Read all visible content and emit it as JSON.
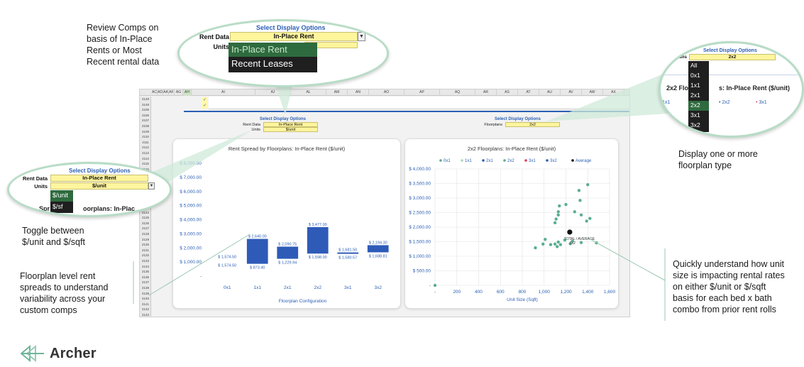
{
  "annotations": {
    "review_comps": [
      "Review Comps on",
      "basis of In-Place",
      "Rents or Most",
      "Recent rental data"
    ],
    "display_floorplan": [
      "Display one or more",
      "floorplan type"
    ],
    "toggle_units": [
      "Toggle between",
      "$/unit and $/sqft"
    ],
    "floorplan_spreads": [
      "Floorplan level rent",
      "spreads to understand",
      "variability across your",
      "custom comps"
    ],
    "unit_size": [
      "Quickly understand how unit",
      "size is impacting rental rates",
      "on either $/unit or $/sqft",
      "basis for each bed x bath",
      "combo from prior rent rolls"
    ]
  },
  "bubble_rent": {
    "title": "Select Display Options",
    "rent_label": "Rent Data",
    "rent_value": "In-Place Rent",
    "units_label": "Units",
    "options": [
      "In-Place Rent",
      "Recent Leases"
    ],
    "selected": "In-Place Rent"
  },
  "bubble_units": {
    "title": "Select Display Options",
    "rent_label": "Rent Data",
    "rent_value": "In-Place Rent",
    "units_label": "Units",
    "units_value": "$/unit",
    "options": [
      "$/unit",
      "$/sf"
    ],
    "selected": "$/unit",
    "behind_text": "Spr",
    "behind_text2": "oorplans: In-Plac"
  },
  "bubble_floorplans": {
    "title": "Select Display Options",
    "label": "orplans",
    "value": "2x2",
    "options": [
      "All",
      "0x1",
      "1x1",
      "2x1",
      "2x2",
      "3x1",
      "3x2"
    ],
    "selected": "2x2",
    "behind_title_a": "2x2 Flo",
    "behind_title_b": "s: In-Place Rent ($/unit)",
    "behind_legend": [
      "1x1",
      "2x2",
      "3x1"
    ]
  },
  "sheet": {
    "columns": [
      "AC",
      "AD",
      "AA",
      "AF",
      "AG",
      "AH",
      "AI",
      "AJ",
      "AL",
      "AM",
      "AN",
      "AO",
      "AP",
      "AQ",
      "AR",
      "AS",
      "AT",
      "AU",
      "AV",
      "AW",
      "AX",
      "AY",
      "AZ"
    ],
    "selected_column": "AH",
    "rows": [
      "2148",
      "2149",
      "2105",
      "2106",
      "2107",
      "2108",
      "2109",
      "2110",
      "2111",
      "2112",
      "2113",
      "2114",
      "2115",
      "2116",
      "2117",
      "2118",
      "2119",
      "2120",
      "2121",
      "2122",
      "2123",
      "2124",
      "2125",
      "2126",
      "2127",
      "2128",
      "2129",
      "2130",
      "2131",
      "2132",
      "2133",
      "2134",
      "2135",
      "2136",
      "2137",
      "2138",
      "2139",
      "2140",
      "2141",
      "2142",
      "2143"
    ],
    "check_marks": [
      "✓",
      "✓"
    ],
    "left_options": {
      "title": "Select Display Options",
      "rent_label": "Rent Data",
      "rent_value": "In-Place Rent",
      "units_label": "Units",
      "units_value": "$/unit"
    },
    "right_options": {
      "title": "Select Display Options",
      "label": "Floorplans",
      "value": "2x2"
    }
  },
  "bar_chart": {
    "title": "Rent Spread by Floorplans: In-Place Rent ($/unit)",
    "xlabel": "Floorplan Configuration",
    "bar_color": "#2e5bb8"
  },
  "scatter_chart": {
    "title": "2x2 Floorplans: In-Place Rent ($/unit)",
    "xlabel": "Unit Size (Sqft)",
    "annotation": "TOTAL / AVERAGE",
    "annotation2": "2x2",
    "point_color": "#5aae8f"
  },
  "chart_data": [
    {
      "type": "bar",
      "title": "Rent Spread by Floorplans: In-Place Rent ($/unit)",
      "xlabel": "Floorplan Configuration",
      "categories": [
        "0x1",
        "1x1",
        "2x1",
        "2x2",
        "3x1",
        "3x2"
      ],
      "series": [
        {
          "values_low": [
            null,
            873.4,
            1229.94,
            1598.0,
            1580.57,
            1688.81
          ],
          "values_high": [
            null,
            2640.0,
            2090.75,
            3477.0,
            1681.5,
            2194.3
          ]
        }
      ],
      "extra_labels": {
        "0x1": [
          "$ 1,574.50",
          "$ 1,574.50"
        ]
      },
      "y_ticks": [
        "$ 8,000.00",
        "$ 7,000.00",
        "$ 6,000.00",
        "$ 5,000.00",
        "$ 4,000.00",
        "$ 3,000.00",
        "$ 2,000.00",
        "$ 1,000.00",
        "-"
      ],
      "ylim": [
        0,
        8000
      ],
      "grid": false
    },
    {
      "type": "scatter",
      "title": "2x2 Floorplans: In-Place Rent ($/unit)",
      "xlabel": "Unit Size (Sqft)",
      "legend": [
        "0x1",
        "1x1",
        "2x1",
        "2x2",
        "3x1",
        "3x2",
        "Average"
      ],
      "legend_colors": [
        "#5aae8f",
        "#a8d8c0",
        "#2b5fb4",
        "#5aae8f",
        "#e04060",
        "#2b5fb4",
        "#111111"
      ],
      "x_ticks": [
        "-",
        "200",
        "400",
        "600",
        "800",
        "1,000",
        "1,200",
        "1,400",
        "1,600"
      ],
      "y_ticks": [
        "$ 4,000.00",
        "$ 3,500.00",
        "$ 3,000.00",
        "$ 2,500.00",
        "$ 2,000.00",
        "$ 1,500.00",
        "$ 1,000.00",
        "$ 500.00",
        "-"
      ],
      "xlim": [
        0,
        1600
      ],
      "ylim": [
        0,
        4000
      ],
      "grid": true,
      "points": [
        {
          "x": 0,
          "y": 0
        },
        {
          "x": 920,
          "y": 1290
        },
        {
          "x": 990,
          "y": 1420
        },
        {
          "x": 1010,
          "y": 1580
        },
        {
          "x": 1060,
          "y": 1400
        },
        {
          "x": 1100,
          "y": 1420
        },
        {
          "x": 1120,
          "y": 1330
        },
        {
          "x": 1130,
          "y": 1490
        },
        {
          "x": 1150,
          "y": 1400
        },
        {
          "x": 1100,
          "y": 2150
        },
        {
          "x": 1110,
          "y": 2280
        },
        {
          "x": 1130,
          "y": 2420
        },
        {
          "x": 1130,
          "y": 2530
        },
        {
          "x": 1140,
          "y": 2730
        },
        {
          "x": 1190,
          "y": 1560
        },
        {
          "x": 1200,
          "y": 2780
        },
        {
          "x": 1240,
          "y": 1430
        },
        {
          "x": 1260,
          "y": 1520
        },
        {
          "x": 1280,
          "y": 2530
        },
        {
          "x": 1320,
          "y": 3260
        },
        {
          "x": 1330,
          "y": 2920
        },
        {
          "x": 1340,
          "y": 2420
        },
        {
          "x": 1340,
          "y": 1470
        },
        {
          "x": 1390,
          "y": 2210
        },
        {
          "x": 1400,
          "y": 3460
        },
        {
          "x": 1420,
          "y": 2300
        },
        {
          "x": 1480,
          "y": 1460
        }
      ],
      "average": {
        "x": 1235,
        "y": 1830
      }
    }
  ],
  "logo": {
    "text": "Archer"
  }
}
